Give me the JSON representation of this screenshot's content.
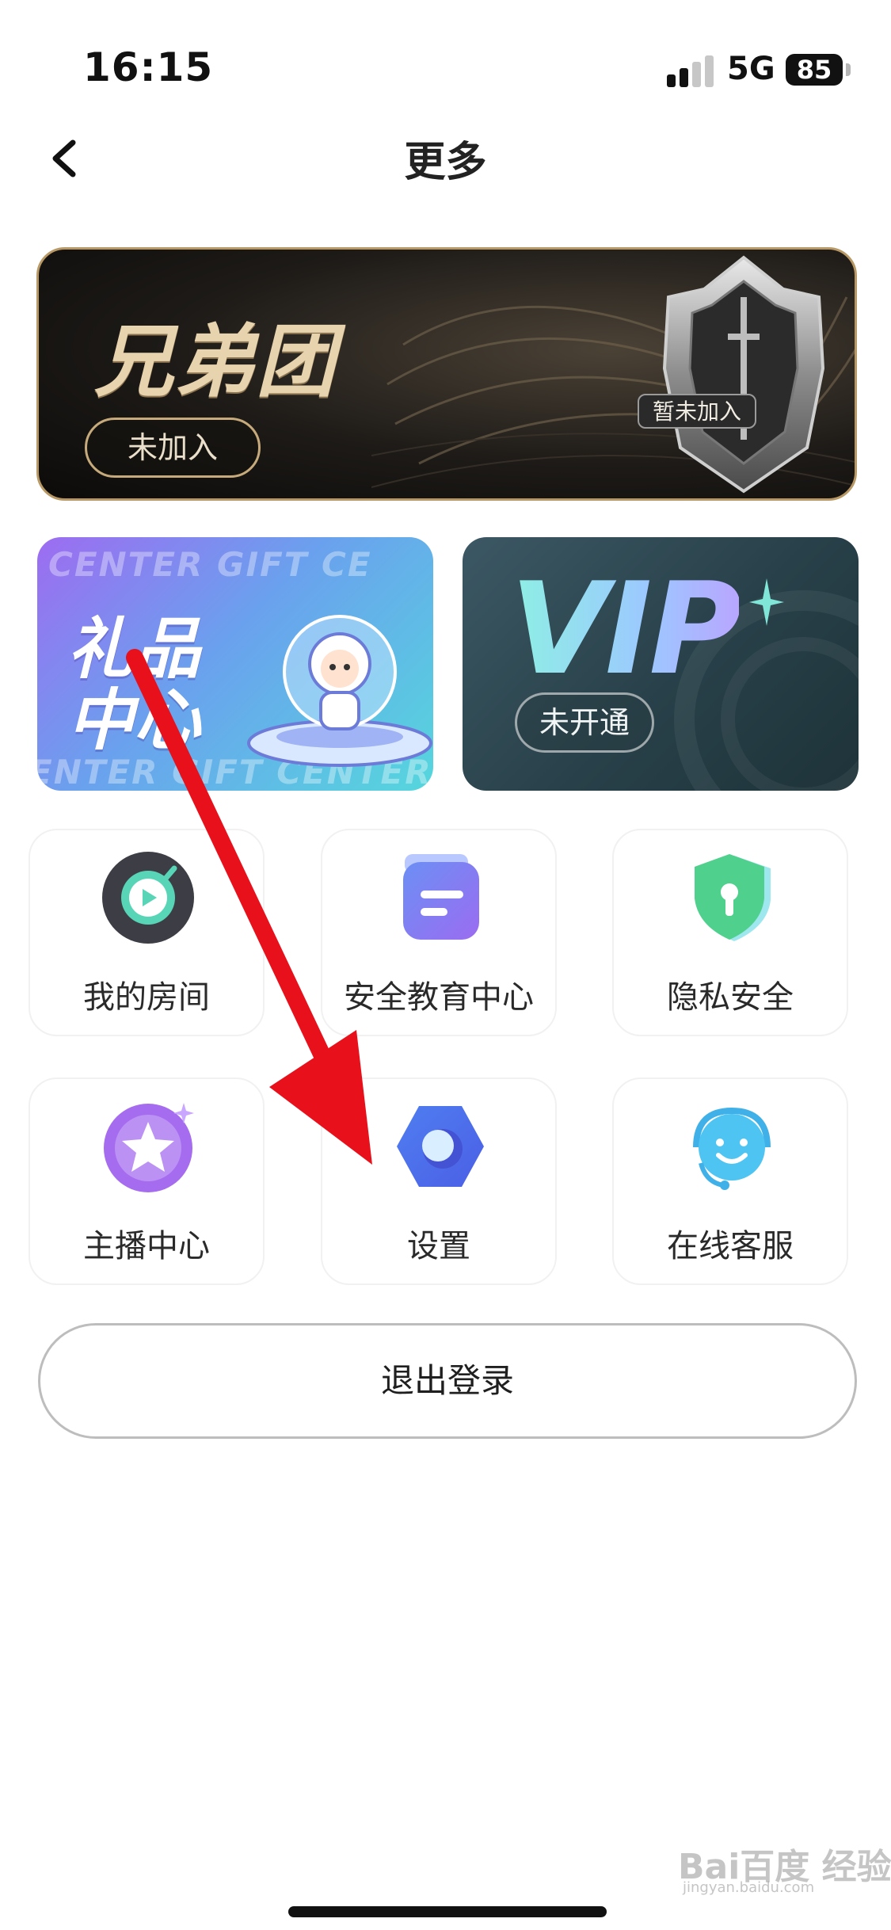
{
  "status_bar": {
    "time": "16:15",
    "network": "5G",
    "battery": "85"
  },
  "nav": {
    "title": "更多",
    "back_icon": "chevron-left-icon"
  },
  "brotherhood": {
    "title": "兄弟团",
    "status": "未加入",
    "badge_label": "暂未加入"
  },
  "gift_center": {
    "title": "礼品中心",
    "deco_top": "CENTER   GIFT   CE",
    "deco_bottom": "ENTER   GIFT   CENTER"
  },
  "vip": {
    "title": "VIP",
    "status": "未开通"
  },
  "grid": {
    "items": [
      {
        "label": "我的房间",
        "icon": "my-room-icon",
        "color": "#3d3d45"
      },
      {
        "label": "安全教育中心",
        "icon": "safety-education-icon",
        "color": "#7b73f0"
      },
      {
        "label": "隐私安全",
        "icon": "privacy-shield-icon",
        "color": "#4fd08c"
      },
      {
        "label": "主播中心",
        "icon": "star-icon",
        "color": "#a66cf0"
      },
      {
        "label": "设置",
        "icon": "settings-hexagon-icon",
        "color": "#4f7ef0"
      },
      {
        "label": "在线客服",
        "icon": "customer-service-icon",
        "color": "#4ec4f2"
      }
    ]
  },
  "logout": {
    "label": "退出登录"
  },
  "watermark": {
    "text": "Bai百度 经验",
    "sub": "jingyan.baidu.com"
  },
  "colors": {
    "annotation_arrow": "#e8101a",
    "banner_gold": "#e7d3ad"
  }
}
